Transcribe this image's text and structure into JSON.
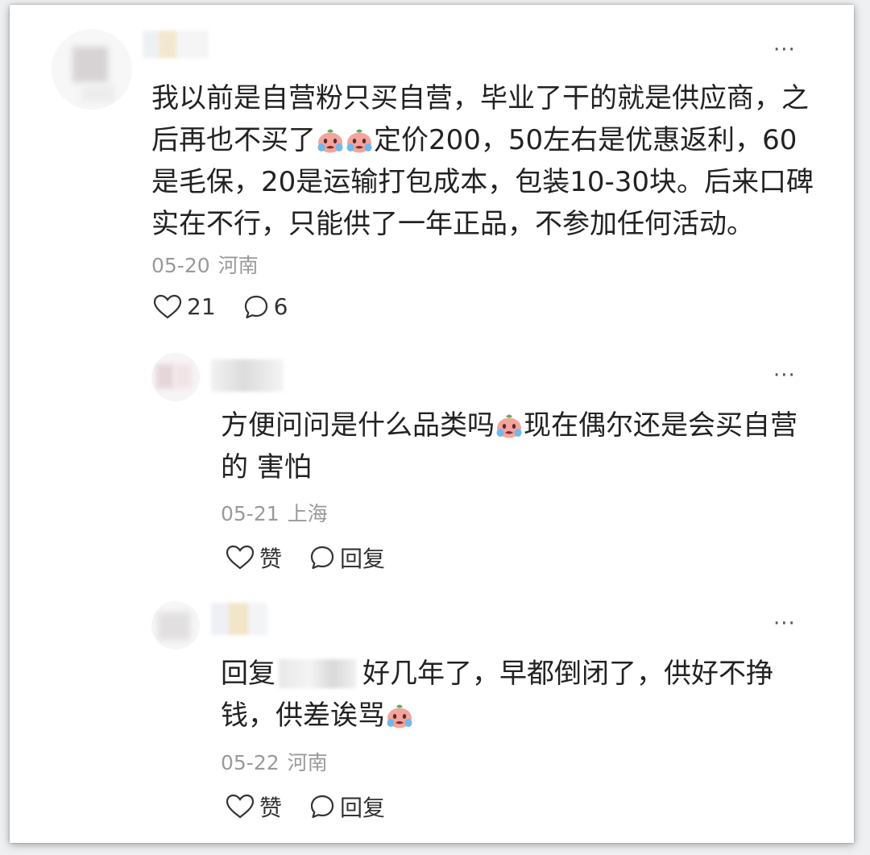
{
  "comments": [
    {
      "text_before_emoji": "我以前是自营粉只买自营，毕业了干的就是供应商，之后再也不买了",
      "text_after_emoji": "定价200，50左右是优惠返利，60是毛保，20是运输打包成本，包装10-30块。后来口碑实在不行，只能供了一年正品，不参加任何活动。",
      "date": "05-20",
      "location": "河南",
      "like_count": "21",
      "reply_count": "6",
      "more_label": "···"
    },
    {
      "text_before_emoji": "方便问问是什么品类吗",
      "text_after_emoji": "现在偶尔还是会买自营的 害怕",
      "date": "05-21",
      "location": "上海",
      "like_label": "赞",
      "reply_label": "回复",
      "more_label": "···"
    },
    {
      "reply_prefix": "回复",
      "text_main": "好几年了，早都倒闭了，供好不挣钱，供差诶骂",
      "date": "05-22",
      "location": "河南",
      "like_label": "赞",
      "reply_label": "回复",
      "more_label": "···"
    }
  ],
  "icons": {
    "heart": "heart-icon",
    "comment": "comment-bubble-icon",
    "emoji": "crying-emoji-icon"
  },
  "colors": {
    "text": "#222222",
    "meta": "#9a9a9a",
    "emoji_face": "#f3a39b"
  }
}
